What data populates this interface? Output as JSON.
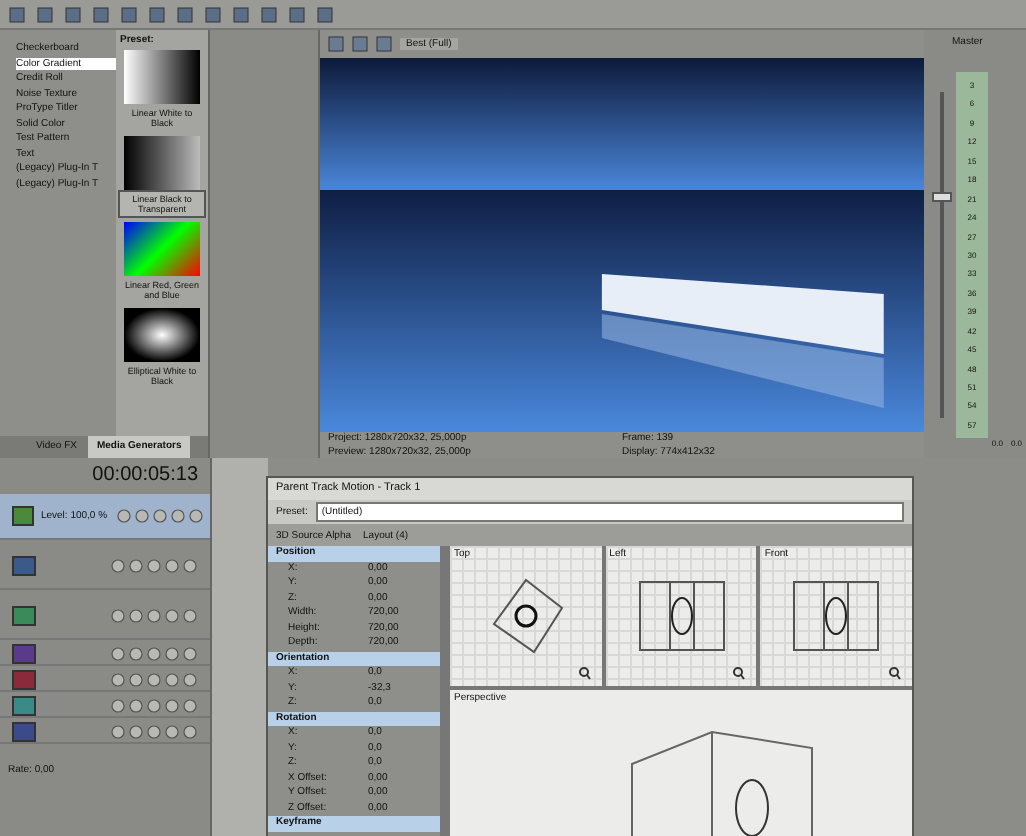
{
  "generators": {
    "items": [
      {
        "label": "Checkerboard",
        "selected": false
      },
      {
        "label": "Color Gradient",
        "selected": true
      },
      {
        "label": "Credit Roll",
        "selected": false
      },
      {
        "label": "Noise Texture",
        "selected": false
      },
      {
        "label": "ProType Titler",
        "selected": false
      },
      {
        "label": "Solid Color",
        "selected": false
      },
      {
        "label": "Test Pattern",
        "selected": false
      },
      {
        "label": "Text",
        "selected": false
      },
      {
        "label": "(Legacy) Plug-In T",
        "selected": false
      },
      {
        "label": "(Legacy) Plug-In T",
        "selected": false
      }
    ]
  },
  "presets": {
    "label": "Preset:",
    "items": [
      {
        "label": "Linear White to Black",
        "kind": "white-black",
        "selected": false
      },
      {
        "label": "Linear Black to Transparent",
        "kind": "black-transparent",
        "selected": true
      },
      {
        "label": "Linear Red, Green and Blue",
        "kind": "rgb",
        "selected": false
      },
      {
        "label": "Elliptical White to Black",
        "kind": "elliptical",
        "selected": false
      }
    ]
  },
  "tabs": [
    {
      "label": "Video FX",
      "selected": false
    },
    {
      "label": "Media Generators",
      "selected": true
    }
  ],
  "preview": {
    "quality": "Best (Full)",
    "info": [
      {
        "label": "Project:",
        "value": "1280x720x32, 25,000p"
      },
      {
        "label": "Preview:",
        "value": "1280x720x32, 25,000p"
      },
      {
        "label": "Frame:",
        "value": "139"
      },
      {
        "label": "Display:",
        "value": "774x412x32"
      }
    ]
  },
  "master": {
    "title": "Master",
    "level": 0.66,
    "scale": [
      "3",
      "6",
      "9",
      "12",
      "15",
      "18",
      "21",
      "24",
      "27",
      "30",
      "33",
      "36",
      "39",
      "42",
      "45",
      "48",
      "51",
      "54",
      "57"
    ],
    "readings": [
      "0.0",
      "0.0"
    ]
  },
  "timeline": {
    "time": "00:00:05:13",
    "level_label": "Level: 100,0 %",
    "rate": "Rate: 0,00",
    "tracks": [
      {
        "color": "#4a8a3a",
        "selected": true
      },
      {
        "color": "#3a5a8a",
        "selected": false
      },
      {
        "color": "#3a8a5a",
        "selected": false
      },
      {
        "color": "#5a3a8a",
        "selected": false
      },
      {
        "color": "#8a2a3a",
        "selected": false
      },
      {
        "color": "#3a8a8a",
        "selected": false
      },
      {
        "color": "#3a4a8a",
        "selected": false
      }
    ]
  },
  "dialog": {
    "title": "Parent Track Motion - Track 1",
    "preset_label": "Preset:",
    "preset": "(Untitled)",
    "source_alpha": "3D Source Alpha",
    "layout": "Layout (4)",
    "sections": [
      {
        "title": "Position",
        "rows": [
          {
            "label": "X:",
            "value": "0,00"
          },
          {
            "label": "Y:",
            "value": "0,00"
          },
          {
            "label": "Z:",
            "value": "0,00"
          },
          {
            "label": "Width:",
            "value": "720,00"
          },
          {
            "label": "Height:",
            "value": "720,00"
          },
          {
            "label": "Depth:",
            "value": "720,00"
          }
        ]
      },
      {
        "title": "Orientation",
        "rows": [
          {
            "label": "X:",
            "value": "0,0"
          },
          {
            "label": "Y:",
            "value": "-32,3"
          },
          {
            "label": "Z:",
            "value": "0,0"
          }
        ]
      },
      {
        "title": "Rotation",
        "rows": [
          {
            "label": "X:",
            "value": "0,0"
          },
          {
            "label": "Y:",
            "value": "0,0"
          },
          {
            "label": "Z:",
            "value": "0,0"
          },
          {
            "label": "X Offset:",
            "value": "0,00"
          },
          {
            "label": "Y Offset:",
            "value": "0,00"
          },
          {
            "label": "Z Offset:",
            "value": "0,00"
          }
        ]
      },
      {
        "title": "Keyframe"
      }
    ],
    "views": [
      {
        "title": "Top",
        "kind": "top"
      },
      {
        "title": "Left",
        "kind": "side"
      },
      {
        "title": "Front",
        "kind": "side"
      },
      {
        "title": "Perspective",
        "kind": "perspective"
      }
    ]
  }
}
